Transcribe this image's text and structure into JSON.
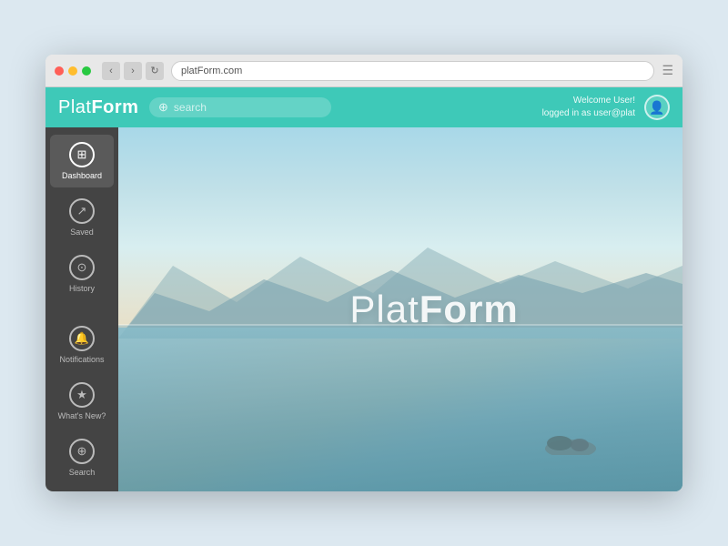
{
  "browser": {
    "url": "platForm.com",
    "back_label": "‹",
    "forward_label": "›",
    "refresh_label": "↻"
  },
  "app": {
    "logo": {
      "light": "Plat",
      "bold": "Form"
    },
    "search": {
      "placeholder": "search"
    },
    "user": {
      "welcome_line1": "Welcome User!",
      "welcome_line2": "logged in as user@plat",
      "avatar_icon": "👤"
    },
    "hero_brand": {
      "light": "Plat",
      "bold": "Form"
    }
  },
  "sidebar": {
    "items": [
      {
        "id": "dashboard",
        "label": "Dashboard",
        "icon": "⊞",
        "active": true
      },
      {
        "id": "saved",
        "label": "Saved",
        "icon": "↗",
        "active": false
      },
      {
        "id": "history",
        "label": "History",
        "icon": "⊙",
        "active": false
      },
      {
        "id": "notifications",
        "label": "Notifications",
        "icon": "🔔",
        "active": false
      },
      {
        "id": "whatsnew",
        "label": "What's New?",
        "icon": "★",
        "active": false
      },
      {
        "id": "search",
        "label": "Search",
        "icon": "⊕",
        "active": false
      }
    ]
  }
}
